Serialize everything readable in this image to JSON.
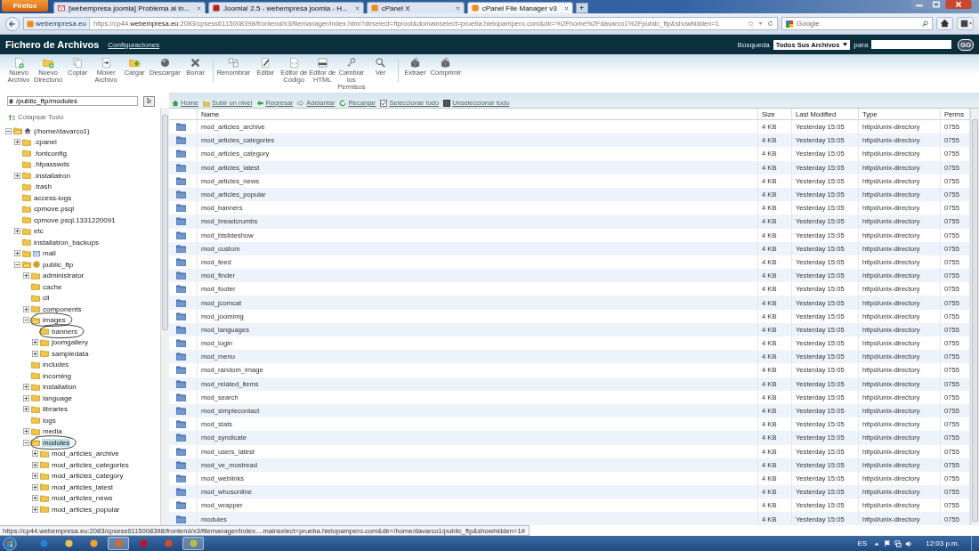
{
  "browser": {
    "menu_button": "Firefox",
    "tabs": [
      {
        "title": "[webempresa joomla] Problema al in...",
        "kind": "mail",
        "selected": false
      },
      {
        "title": "Joomla! 2.5 - webempresa joomla - H...",
        "kind": "webempresa",
        "selected": false
      },
      {
        "title": "cPanel X",
        "kind": "cpanel",
        "selected": false
      },
      {
        "title": "cPanel File Manager v3",
        "kind": "cpanel",
        "selected": true
      }
    ],
    "new_tab": "+",
    "site_badge": "webempresa.eu",
    "url": "https://cp44.**webempresa.eu**:2083/cpsess6115008398/frontend/x3/filemanager/index.html?dirselect=ftproot&domainselect=prueba.hielopampero.com&dir=%2Fhome%2Fdavarco1%2Fpublic_ftp&showhidden=1",
    "search_placeholder": "Google"
  },
  "header": {
    "title": "Fichero de Archivos",
    "settings_link": "Configuraciones",
    "search_label": "Búsqueda",
    "search_scope": "Todos Sus Archivos",
    "for_label": "para",
    "go": "GO"
  },
  "toolbar": [
    {
      "label": "Nuevo\nArchivo",
      "kind": "new-file",
      "separator_after": false
    },
    {
      "label": "Nuevo\nDirectorio",
      "kind": "new-folder",
      "separator_after": false
    },
    {
      "label": "Copiar",
      "kind": "copy",
      "separator_after": false
    },
    {
      "label": "Mover\nArchivo",
      "kind": "move",
      "separator_after": false
    },
    {
      "label": "Cargar",
      "kind": "upload",
      "separator_after": false
    },
    {
      "label": "Descargar",
      "kind": "download",
      "separator_after": false
    },
    {
      "label": "Borrar",
      "kind": "delete",
      "separator_after": true
    },
    {
      "label": "Renombrar",
      "kind": "rename",
      "separator_after": false
    },
    {
      "label": "Editar",
      "kind": "edit",
      "separator_after": false
    },
    {
      "label": "Editor de\nCódigo",
      "kind": "code",
      "separator_after": false
    },
    {
      "label": "Editor de\nHTML",
      "kind": "html",
      "separator_after": false
    },
    {
      "label": "Cambiar\nlos\nPermisos",
      "kind": "permissions",
      "separator_after": false
    },
    {
      "label": "Ver",
      "kind": "view",
      "separator_after": true
    },
    {
      "label": "Extraer",
      "kind": "extract",
      "separator_after": false
    },
    {
      "label": "Comprimir",
      "kind": "compress",
      "separator_after": false
    }
  ],
  "path_field": "/public_ftp/modules",
  "path_go": "Ir",
  "nav": [
    {
      "label": "Home",
      "kind": "home"
    },
    {
      "label": "Subir un nivel",
      "kind": "up"
    },
    {
      "label": "Regresar",
      "kind": "back"
    },
    {
      "label": "Adelantar",
      "kind": "forward"
    },
    {
      "label": "Recargar",
      "kind": "reload"
    },
    {
      "label": "Seleccionar todo",
      "kind": "select-all"
    },
    {
      "label": "Unseleccionar todo",
      "kind": "unselect-all"
    }
  ],
  "tree": {
    "collapse_all": "Colapsar Todo",
    "root": {
      "label": "(/home/davarco1)",
      "kind": "home",
      "toggle": true,
      "expanded": true,
      "selected": false,
      "annotated": false,
      "children": [
        {
          "label": ".cpanel",
          "kind": "folder",
          "toggle": true,
          "expanded": false,
          "selected": false,
          "annotated": false
        },
        {
          "label": ".fontconfig",
          "kind": "folder",
          "toggle": false,
          "expanded": false,
          "selected": false,
          "annotated": false
        },
        {
          "label": ".htpasswds",
          "kind": "folder",
          "toggle": false,
          "expanded": false,
          "selected": false,
          "annotated": false
        },
        {
          "label": ".installatron",
          "kind": "folder",
          "toggle": true,
          "expanded": false,
          "selected": false,
          "annotated": false
        },
        {
          "label": ".trash",
          "kind": "folder",
          "toggle": false,
          "expanded": false,
          "selected": false,
          "annotated": false
        },
        {
          "label": "access-logs",
          "kind": "folder",
          "toggle": false,
          "expanded": false,
          "selected": false,
          "annotated": false
        },
        {
          "label": "cpmove.psql",
          "kind": "folder",
          "toggle": false,
          "expanded": false,
          "selected": false,
          "annotated": false
        },
        {
          "label": "cpmove.psql.1331220091",
          "kind": "folder",
          "toggle": false,
          "expanded": false,
          "selected": false,
          "annotated": false
        },
        {
          "label": "etc",
          "kind": "folder",
          "toggle": true,
          "expanded": false,
          "selected": false,
          "annotated": false
        },
        {
          "label": "installatron_backups",
          "kind": "folder",
          "toggle": false,
          "expanded": false,
          "selected": false,
          "annotated": false
        },
        {
          "label": "mail",
          "kind": "mail",
          "toggle": true,
          "expanded": false,
          "selected": false,
          "annotated": false
        },
        {
          "label": "public_ftp",
          "kind": "web",
          "toggle": true,
          "expanded": true,
          "selected": false,
          "annotated": false,
          "children": [
            {
              "label": "administrator",
              "kind": "folder",
              "toggle": true,
              "expanded": false,
              "selected": false,
              "annotated": false
            },
            {
              "label": "cache",
              "kind": "folder",
              "toggle": false,
              "expanded": false,
              "selected": false,
              "annotated": false
            },
            {
              "label": "cli",
              "kind": "folder",
              "toggle": false,
              "expanded": false,
              "selected": false,
              "annotated": false
            },
            {
              "label": "components",
              "kind": "folder",
              "toggle": true,
              "expanded": false,
              "selected": false,
              "annotated": false
            },
            {
              "label": "images",
              "kind": "folder",
              "toggle": true,
              "expanded": true,
              "selected": false,
              "annotated": true,
              "children": [
                {
                  "label": "banners",
                  "kind": "folder",
                  "toggle": false,
                  "expanded": false,
                  "selected": false,
                  "annotated": true
                },
                {
                  "label": "joomgallery",
                  "kind": "folder",
                  "toggle": true,
                  "expanded": false,
                  "selected": false,
                  "annotated": false
                },
                {
                  "label": "sampledata",
                  "kind": "folder",
                  "toggle": true,
                  "expanded": false,
                  "selected": false,
                  "annotated": false
                }
              ]
            },
            {
              "label": "includes",
              "kind": "folder",
              "toggle": false,
              "expanded": false,
              "selected": false,
              "annotated": false
            },
            {
              "label": "incoming",
              "kind": "folder",
              "toggle": false,
              "expanded": false,
              "selected": false,
              "annotated": false
            },
            {
              "label": "installation",
              "kind": "folder",
              "toggle": true,
              "expanded": false,
              "selected": false,
              "annotated": false
            },
            {
              "label": "language",
              "kind": "folder",
              "toggle": true,
              "expanded": false,
              "selected": false,
              "annotated": false
            },
            {
              "label": "libraries",
              "kind": "folder",
              "toggle": true,
              "expanded": false,
              "selected": false,
              "annotated": false
            },
            {
              "label": "logs",
              "kind": "folder",
              "toggle": false,
              "expanded": false,
              "selected": false,
              "annotated": false
            },
            {
              "label": "media",
              "kind": "folder",
              "toggle": true,
              "expanded": false,
              "selected": false,
              "annotated": false
            },
            {
              "label": "modules",
              "kind": "folder",
              "toggle": true,
              "expanded": true,
              "selected": true,
              "annotated": true,
              "children": [
                {
                  "label": "mod_articles_archive",
                  "kind": "folder",
                  "toggle": true,
                  "expanded": false,
                  "selected": false,
                  "annotated": false
                },
                {
                  "label": "mod_articles_categories",
                  "kind": "folder",
                  "toggle": true,
                  "expanded": false,
                  "selected": false,
                  "annotated": false
                },
                {
                  "label": "mod_articles_category",
                  "kind": "folder",
                  "toggle": true,
                  "expanded": false,
                  "selected": false,
                  "annotated": false
                },
                {
                  "label": "mod_articles_latest",
                  "kind": "folder",
                  "toggle": true,
                  "expanded": false,
                  "selected": false,
                  "annotated": false
                },
                {
                  "label": "mod_articles_news",
                  "kind": "folder",
                  "toggle": true,
                  "expanded": false,
                  "selected": false,
                  "annotated": false
                },
                {
                  "label": "mod_articles_popular",
                  "kind": "folder",
                  "toggle": true,
                  "expanded": false,
                  "selected": false,
                  "annotated": false
                }
              ]
            }
          ]
        }
      ]
    }
  },
  "table": {
    "columns": [
      "Name",
      "Size",
      "Last Modified",
      "Type",
      "Perms"
    ],
    "rows": [
      {
        "name": "mod_articles_archive",
        "size": "4 KB",
        "modified": "Yesterday 15:05",
        "type": "httpd/unix-directory",
        "perms": "0755"
      },
      {
        "name": "mod_articles_categories",
        "size": "4 KB",
        "modified": "Yesterday 15:05",
        "type": "httpd/unix-directory",
        "perms": "0755"
      },
      {
        "name": "mod_articles_category",
        "size": "4 KB",
        "modified": "Yesterday 15:05",
        "type": "httpd/unix-directory",
        "perms": "0755"
      },
      {
        "name": "mod_articles_latest",
        "size": "4 KB",
        "modified": "Yesterday 15:05",
        "type": "httpd/unix-directory",
        "perms": "0755"
      },
      {
        "name": "mod_articles_news",
        "size": "4 KB",
        "modified": "Yesterday 15:05",
        "type": "httpd/unix-directory",
        "perms": "0755"
      },
      {
        "name": "mod_articles_popular",
        "size": "4 KB",
        "modified": "Yesterday 15:05",
        "type": "httpd/unix-directory",
        "perms": "0755"
      },
      {
        "name": "mod_banners",
        "size": "4 KB",
        "modified": "Yesterday 15:05",
        "type": "httpd/unix-directory",
        "perms": "0755"
      },
      {
        "name": "mod_breadcrumbs",
        "size": "4 KB",
        "modified": "Yesterday 15:05",
        "type": "httpd/unix-directory",
        "perms": "0755"
      },
      {
        "name": "mod_btslideshow",
        "size": "4 KB",
        "modified": "Yesterday 15:05",
        "type": "httpd/unix-directory",
        "perms": "0755"
      },
      {
        "name": "mod_custom",
        "size": "4 KB",
        "modified": "Yesterday 15:05",
        "type": "httpd/unix-directory",
        "perms": "0755"
      },
      {
        "name": "mod_feed",
        "size": "4 KB",
        "modified": "Yesterday 15:05",
        "type": "httpd/unix-directory",
        "perms": "0755"
      },
      {
        "name": "mod_finder",
        "size": "4 KB",
        "modified": "Yesterday 15:05",
        "type": "httpd/unix-directory",
        "perms": "0755"
      },
      {
        "name": "mod_footer",
        "size": "4 KB",
        "modified": "Yesterday 15:05",
        "type": "httpd/unix-directory",
        "perms": "0755"
      },
      {
        "name": "mod_jcomcat",
        "size": "4 KB",
        "modified": "Yesterday 15:05",
        "type": "httpd/unix-directory",
        "perms": "0755"
      },
      {
        "name": "mod_joomimg",
        "size": "4 KB",
        "modified": "Yesterday 15:05",
        "type": "httpd/unix-directory",
        "perms": "0755"
      },
      {
        "name": "mod_languages",
        "size": "4 KB",
        "modified": "Yesterday 15:05",
        "type": "httpd/unix-directory",
        "perms": "0755"
      },
      {
        "name": "mod_login",
        "size": "4 KB",
        "modified": "Yesterday 15:05",
        "type": "httpd/unix-directory",
        "perms": "0755"
      },
      {
        "name": "mod_menu",
        "size": "4 KB",
        "modified": "Yesterday 15:05",
        "type": "httpd/unix-directory",
        "perms": "0755"
      },
      {
        "name": "mod_random_image",
        "size": "4 KB",
        "modified": "Yesterday 15:05",
        "type": "httpd/unix-directory",
        "perms": "0755"
      },
      {
        "name": "mod_related_items",
        "size": "4 KB",
        "modified": "Yesterday 15:05",
        "type": "httpd/unix-directory",
        "perms": "0755"
      },
      {
        "name": "mod_search",
        "size": "4 KB",
        "modified": "Yesterday 15:05",
        "type": "httpd/unix-directory",
        "perms": "0755"
      },
      {
        "name": "mod_simplecontact",
        "size": "4 KB",
        "modified": "Yesterday 15:05",
        "type": "httpd/unix-directory",
        "perms": "0755"
      },
      {
        "name": "mod_stats",
        "size": "4 KB",
        "modified": "Yesterday 15:05",
        "type": "httpd/unix-directory",
        "perms": "0755"
      },
      {
        "name": "mod_syndicate",
        "size": "4 KB",
        "modified": "Yesterday 15:05",
        "type": "httpd/unix-directory",
        "perms": "0755"
      },
      {
        "name": "mod_users_latest",
        "size": "4 KB",
        "modified": "Yesterday 15:05",
        "type": "httpd/unix-directory",
        "perms": "0755"
      },
      {
        "name": "mod_ve_mostread",
        "size": "4 KB",
        "modified": "Yesterday 15:05",
        "type": "httpd/unix-directory",
        "perms": "0755"
      },
      {
        "name": "mod_weblinks",
        "size": "4 KB",
        "modified": "Yesterday 15:05",
        "type": "httpd/unix-directory",
        "perms": "0755"
      },
      {
        "name": "mod_whosonline",
        "size": "4 KB",
        "modified": "Yesterday 15:05",
        "type": "httpd/unix-directory",
        "perms": "0755"
      },
      {
        "name": "mod_wrapper",
        "size": "4 KB",
        "modified": "Yesterday 15:05",
        "type": "httpd/unix-directory",
        "perms": "0755"
      },
      {
        "name": "modules",
        "size": "4 KB",
        "modified": "Yesterday 15:05",
        "type": "httpd/unix-directory",
        "perms": "0755"
      }
    ]
  },
  "status_bar": "https://cp44.webempresa.eu:2083/cpsess6115008398/frontend/x3/filemanager/index....mainselect=prueba.hielopampero.com&dir=/home/davarco1/public_ftp&showhidden=1#",
  "taskbar": {
    "apps": [
      {
        "color": "#2a7fd4",
        "selected": false
      },
      {
        "color": "#e8c35a",
        "selected": false
      },
      {
        "color": "#f0a030",
        "selected": false
      },
      {
        "color": "#e06a20",
        "selected": true
      },
      {
        "color": "#c0151b",
        "selected": false
      },
      {
        "color": "#d84a2a",
        "selected": false
      },
      {
        "color": "#b8c040",
        "selected": true
      }
    ],
    "language": "ES",
    "clock": "12:03 p.m."
  }
}
